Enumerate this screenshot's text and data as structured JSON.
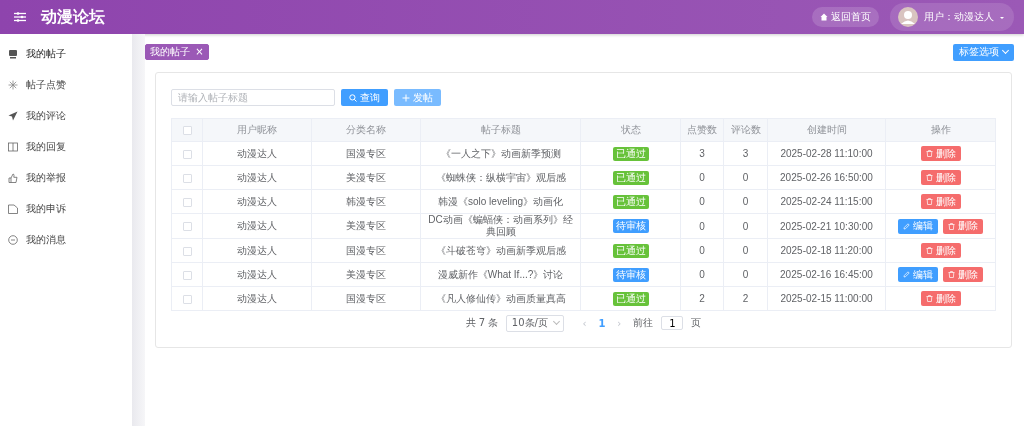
{
  "header": {
    "title": "动漫论坛",
    "home_button": "返回首页",
    "user_label": "用户：动漫达人"
  },
  "sidebar": {
    "items": [
      {
        "label": "我的帖子",
        "selected": true
      },
      {
        "label": "帖子点赞",
        "selected": false
      },
      {
        "label": "我的评论",
        "selected": false
      },
      {
        "label": "我的回复",
        "selected": false
      },
      {
        "label": "我的举报",
        "selected": false
      },
      {
        "label": "我的申诉",
        "selected": false
      },
      {
        "label": "我的消息",
        "selected": false
      }
    ]
  },
  "tabs": [
    {
      "label": "我的帖子",
      "close": "×",
      "selected": true
    }
  ],
  "tab_options": "标签选项",
  "search": {
    "placeholder": "请输入帖子标题",
    "query_button": "查询",
    "post_button": "发帖"
  },
  "table": {
    "header_checked": false,
    "columns": [
      "用户昵称",
      "分类名称",
      "帖子标题",
      "状态",
      "点赞数",
      "评论数",
      "创建时间",
      "操作"
    ],
    "rows": [
      {
        "checked": false,
        "user": "动漫达人",
        "category": "国漫专区",
        "title": "《一人之下》动画新季预测",
        "status": {
          "kind": "approved",
          "label": "已通过"
        },
        "likes": "3",
        "comments": "3",
        "created": "2025-02-28 11:10:00",
        "actions": [
          {
            "kind": "delete",
            "label": "删除"
          }
        ]
      },
      {
        "checked": false,
        "user": "动漫达人",
        "category": "美漫专区",
        "title": "《蜘蛛侠：纵横宇宙》观后感",
        "status": {
          "kind": "approved",
          "label": "已通过"
        },
        "likes": "0",
        "comments": "0",
        "created": "2025-02-26 16:50:00",
        "actions": [
          {
            "kind": "delete",
            "label": "删除"
          }
        ]
      },
      {
        "checked": false,
        "user": "动漫达人",
        "category": "韩漫专区",
        "title": "韩漫《solo leveling》动画化",
        "status": {
          "kind": "approved",
          "label": "已通过"
        },
        "likes": "0",
        "comments": "0",
        "created": "2025-02-24 11:15:00",
        "actions": [
          {
            "kind": "delete",
            "label": "删除"
          }
        ]
      },
      {
        "checked": false,
        "user": "动漫达人",
        "category": "美漫专区",
        "title": "DC动画《蝙蝠侠：动画系列》经典回顾",
        "status": {
          "kind": "pending",
          "label": "待审核"
        },
        "likes": "0",
        "comments": "0",
        "created": "2025-02-21 10:30:00",
        "actions": [
          {
            "kind": "edit",
            "label": "编辑"
          },
          {
            "kind": "delete",
            "label": "删除"
          }
        ]
      },
      {
        "checked": false,
        "user": "动漫达人",
        "category": "国漫专区",
        "title": "《斗破苍穹》动画新季观后感",
        "status": {
          "kind": "approved",
          "label": "已通过"
        },
        "likes": "0",
        "comments": "0",
        "created": "2025-02-18 11:20:00",
        "actions": [
          {
            "kind": "delete",
            "label": "删除"
          }
        ]
      },
      {
        "checked": false,
        "user": "动漫达人",
        "category": "美漫专区",
        "title": "漫威新作《What If...?》讨论",
        "status": {
          "kind": "pending",
          "label": "待审核"
        },
        "likes": "0",
        "comments": "0",
        "created": "2025-02-16 16:45:00",
        "actions": [
          {
            "kind": "edit",
            "label": "编辑"
          },
          {
            "kind": "delete",
            "label": "删除"
          }
        ]
      },
      {
        "checked": false,
        "user": "动漫达人",
        "category": "国漫专区",
        "title": "《凡人修仙传》动画质量真高",
        "status": {
          "kind": "approved",
          "label": "已通过"
        },
        "likes": "2",
        "comments": "2",
        "created": "2025-02-15 11:00:00",
        "actions": [
          {
            "kind": "delete",
            "label": "删除"
          }
        ]
      }
    ]
  },
  "pagination": {
    "total": "共 7 条",
    "page_size": "10条/页",
    "prev": "‹",
    "pages": [
      {
        "label": "1",
        "selected": true
      }
    ],
    "next": "›",
    "goto_label": "前往",
    "goto_value": "1",
    "goto_suffix": "页"
  }
}
